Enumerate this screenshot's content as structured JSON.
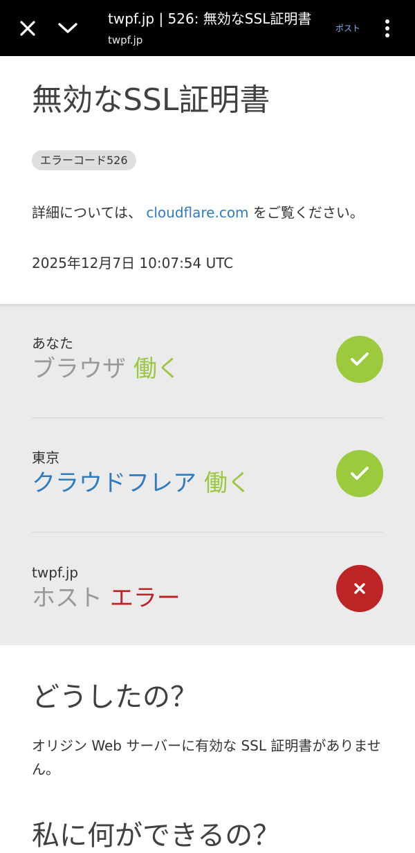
{
  "toolbar": {
    "title": "twpf.jp | 526: 無効なSSL証明書",
    "url": "twpf.jp",
    "post_label": "ポスト",
    "icons": [
      "close-icon",
      "chevron-down-icon",
      "more-vert-icon"
    ]
  },
  "header": {
    "title": "無効なSSL証明書",
    "error_badge": "エラーコード526",
    "details_prefix": "詳細については、",
    "details_link": "cloudflare.com",
    "details_suffix": "をご覧ください。",
    "timestamp": "2025年12月7日 10:07:54 UTC"
  },
  "status": {
    "rows": [
      {
        "label": "あなた",
        "name": "ブラウザ",
        "status": "働く",
        "state": "ok",
        "icon": "check-icon"
      },
      {
        "label": "東京",
        "name": "クラウドフレア",
        "status": "働く",
        "state": "ok",
        "icon": "check-icon"
      },
      {
        "label": "twpf.jp",
        "name": "ホスト",
        "status": "エラー",
        "state": "error",
        "icon": "x-icon"
      }
    ]
  },
  "explanation": {
    "heading": "どうしたの？",
    "body": "オリジン Web サーバーに有効な SSL 証明書がありません。",
    "next_heading": "私に何ができるの？"
  },
  "colors": {
    "ok": "#9bca3e",
    "error": "#bd2426",
    "link": "#2f7bbf",
    "panel_bg": "#ebebeb"
  }
}
